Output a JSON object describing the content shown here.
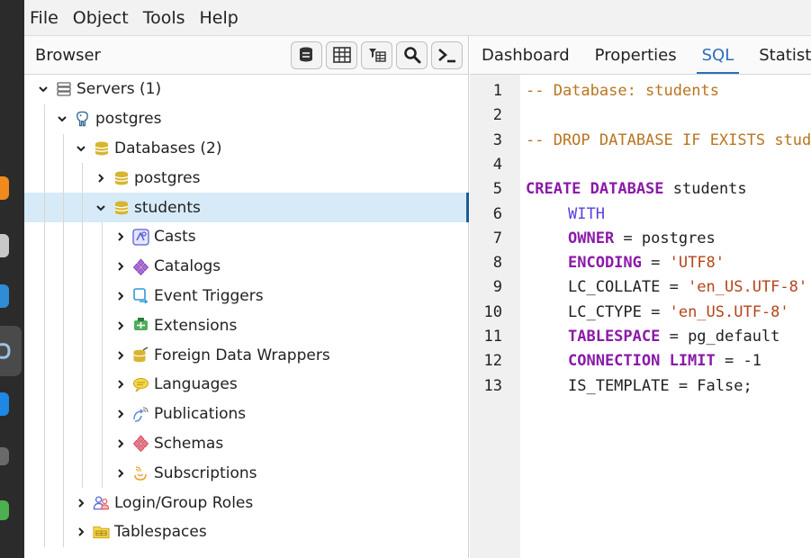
{
  "menu": [
    "File",
    "Object",
    "Tools",
    "Help"
  ],
  "browser": {
    "title": "Browser",
    "tree": [
      {
        "label": "Servers (1)",
        "icon": "servers-icon",
        "expanded": true
      },
      {
        "label": "postgres",
        "icon": "elephant-icon",
        "expanded": true
      },
      {
        "label": "Databases (2)",
        "icon": "databases-icon",
        "expanded": true
      },
      {
        "label": "postgres",
        "icon": "database-icon",
        "expanded": false
      },
      {
        "label": "students",
        "icon": "database-icon",
        "expanded": true
      },
      {
        "label": "Casts",
        "icon": "casts-icon",
        "expanded": false
      },
      {
        "label": "Catalogs",
        "icon": "catalogs-icon",
        "expanded": false
      },
      {
        "label": "Event Triggers",
        "icon": "event-triggers-icon",
        "expanded": false
      },
      {
        "label": "Extensions",
        "icon": "extensions-icon",
        "expanded": false
      },
      {
        "label": "Foreign Data Wrappers",
        "icon": "foreign-data-wrappers-icon",
        "expanded": false
      },
      {
        "label": "Languages",
        "icon": "languages-icon",
        "expanded": false
      },
      {
        "label": "Publications",
        "icon": "publications-icon",
        "expanded": false
      },
      {
        "label": "Schemas",
        "icon": "schemas-icon",
        "expanded": false
      },
      {
        "label": "Subscriptions",
        "icon": "subscriptions-icon",
        "expanded": false
      },
      {
        "label": "Login/Group Roles",
        "icon": "roles-icon",
        "expanded": false
      },
      {
        "label": "Tablespaces",
        "icon": "tablespaces-icon",
        "expanded": false
      }
    ]
  },
  "tabs": [
    "Dashboard",
    "Properties",
    "SQL",
    "Statistics"
  ],
  "active_tab": "SQL",
  "code": {
    "line_numbers": [
      "1",
      "2",
      "3",
      "4",
      "5",
      "6",
      "7",
      "8",
      "9",
      "10",
      "11",
      "12",
      "13"
    ],
    "l1": "-- Database: students",
    "l3": "-- DROP DATABASE IF EXISTS students;",
    "l5_kw": "CREATE DATABASE",
    "l5_rest": " students",
    "l6": "WITH",
    "l7_kw": "OWNER",
    "l7_rest": " = postgres",
    "l8_kw": "ENCODING",
    "l8_eq": " = ",
    "l8_str": "'UTF8'",
    "l9_key": "LC_COLLATE = ",
    "l9_str": "'en_US.UTF-8'",
    "l10_key": "LC_CTYPE = ",
    "l10_str": "'en_US.UTF-8'",
    "l11_kw": "TABLESPACE",
    "l11_rest": " = pg_default",
    "l12_kw": "CONNECTION LIMIT",
    "l12_rest": " = -1",
    "l13": "IS_TEMPLATE = False;"
  },
  "colors": {
    "accent": "#2a6ebd",
    "selected_row": "#d6ebf7",
    "comment": "#b8751f",
    "keyword": "#8a1aa8"
  }
}
